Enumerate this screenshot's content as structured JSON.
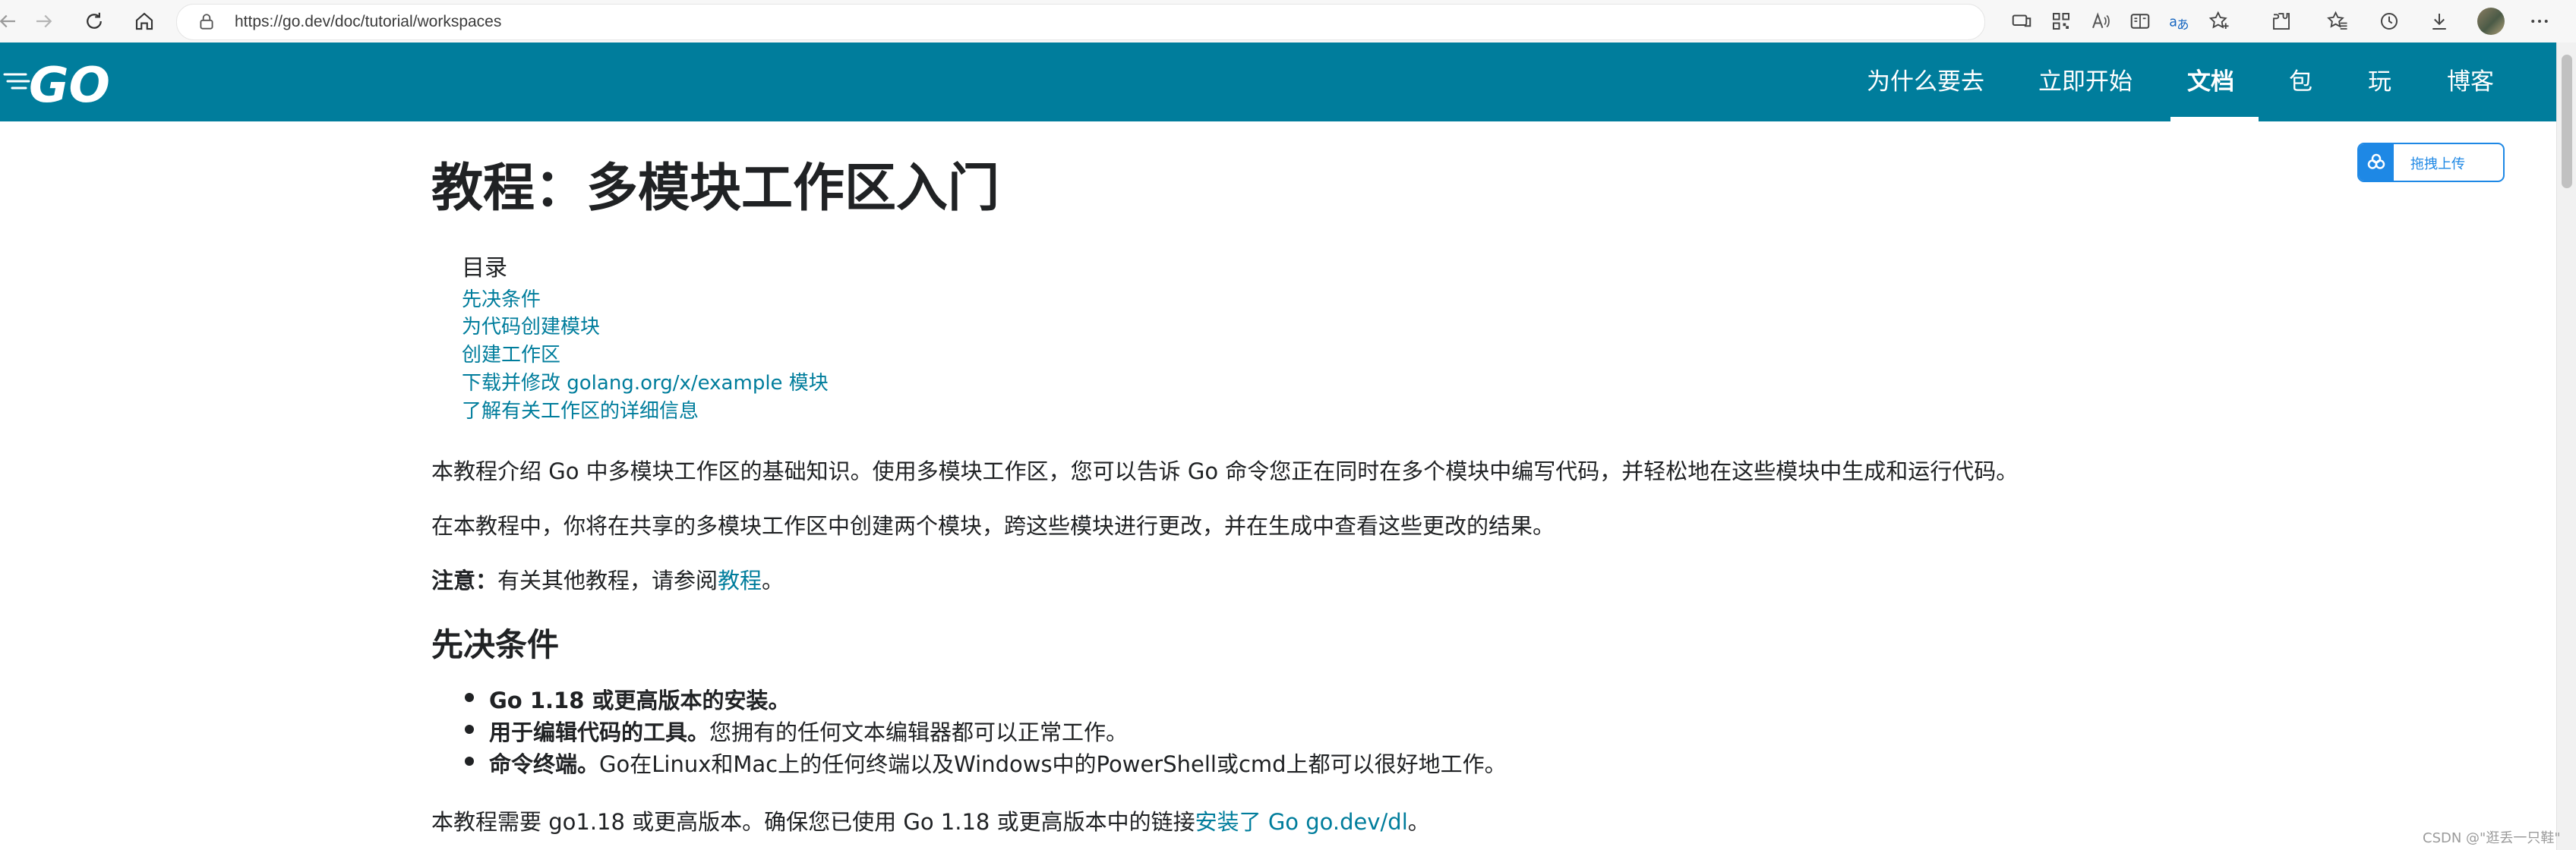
{
  "browser": {
    "url": "https://go.dev/doc/tutorial/workspaces",
    "icons": [
      "back-icon",
      "forward-icon",
      "refresh-icon",
      "home-icon",
      "lock-icon",
      "collections-icon",
      "qr-code-icon",
      "read-aloud-icon",
      "immersive-reader-icon",
      "translate-icon",
      "favorite-add-icon",
      "extensions-icon",
      "favorites-icon",
      "history-icon",
      "downloads-icon",
      "profile-avatar",
      "more-icon"
    ]
  },
  "site": {
    "logo": "GO",
    "nav": [
      "为什么要去",
      "立即开始",
      "文档",
      "包",
      "玩",
      "博客"
    ],
    "active_nav": "文档",
    "brand_color": "#007d9c"
  },
  "page": {
    "title": "教程：多模块工作区入门",
    "toc_title": "目录",
    "toc": [
      "先决条件",
      "为代码创建模块",
      "创建工作区",
      "下载并修改 golang.org/x/example 模块",
      "了解有关工作区的详细信息"
    ],
    "intro": "本教程介绍 Go 中多模块工作区的基础知识。使用多模块工作区，您可以告诉 Go 命令您正在同时在多个模块中编写代码，并轻松地在这些模块中生成和运行代码。",
    "intro2": "在本教程中，你将在共享的多模块工作区中创建两个模块，跨这些模块进行更改，并在生成中查看这些更改的结果。",
    "note": {
      "label": "注意：",
      "text": "有关其他教程，请参阅",
      "link": "教程",
      "end": "。"
    },
    "prereq_heading": "先决条件",
    "prereq_items": [
      {
        "bold": "Go 1.18 或更高版本的安装。",
        "text": ""
      },
      {
        "bold": "用于编辑代码的工具。",
        "text": "您拥有的任何文本编辑器都可以正常工作。"
      },
      {
        "bold": "命令终端。",
        "text": "Go在Linux和Mac上的任何终端以及Windows中的PowerShell或cmd上都可以很好地工作。"
      }
    ],
    "requirement": {
      "text": "本教程需要 go1.18 或更高版本。确保您已使用 Go 1.18 或更高版本中的链接",
      "link": "安装了 Go go.dev/dl",
      "end": "。"
    }
  },
  "upload_widget": {
    "label": "拖拽上传"
  },
  "watermark": "CSDN @\"逛丢一只鞋\""
}
